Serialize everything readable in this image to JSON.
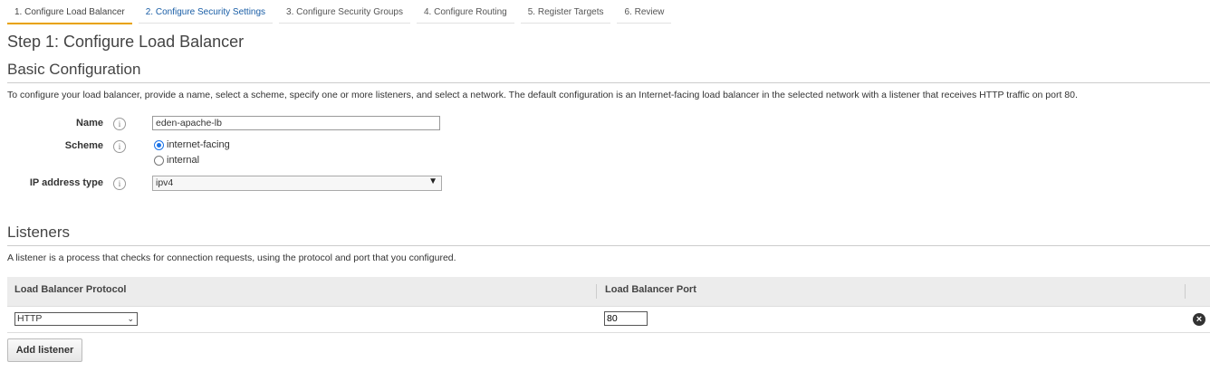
{
  "wizard": {
    "tabs": [
      {
        "label": "1. Configure Load Balancer",
        "active": true
      },
      {
        "label": "2. Configure Security Settings",
        "active": false
      },
      {
        "label": "3. Configure Security Groups",
        "active": false
      },
      {
        "label": "4. Configure Routing",
        "active": false
      },
      {
        "label": "5. Register Targets",
        "active": false
      },
      {
        "label": "6. Review",
        "active": false
      }
    ]
  },
  "page": {
    "title": "Step 1: Configure Load Balancer"
  },
  "basic": {
    "title": "Basic Configuration",
    "description": "To configure your load balancer, provide a name, select a scheme, specify one or more listeners, and select a network. The default configuration is an Internet-facing load balancer in the selected network with a listener that receives HTTP traffic on port 80.",
    "name_label": "Name",
    "name_value": "eden-apache-lb",
    "scheme_label": "Scheme",
    "scheme_options": [
      "internet-facing",
      "internal"
    ],
    "scheme_selected": "internet-facing",
    "ip_label": "IP address type",
    "ip_value": "ipv4",
    "info_glyph": "i"
  },
  "listeners": {
    "title": "Listeners",
    "description": "A listener is a process that checks for connection requests, using the protocol and port that you configured.",
    "col_protocol": "Load Balancer Protocol",
    "col_port": "Load Balancer Port",
    "rows": [
      {
        "protocol": "HTTP",
        "port": "80"
      }
    ],
    "add_label": "Add listener"
  },
  "icons": {
    "info": "info-icon",
    "remove": "remove-listener-icon",
    "dropdown": "chevron-down-icon"
  },
  "colors": {
    "active_tab_accent": "#e8a200",
    "link": "#1a5ea6",
    "header_bg": "#ececec"
  }
}
